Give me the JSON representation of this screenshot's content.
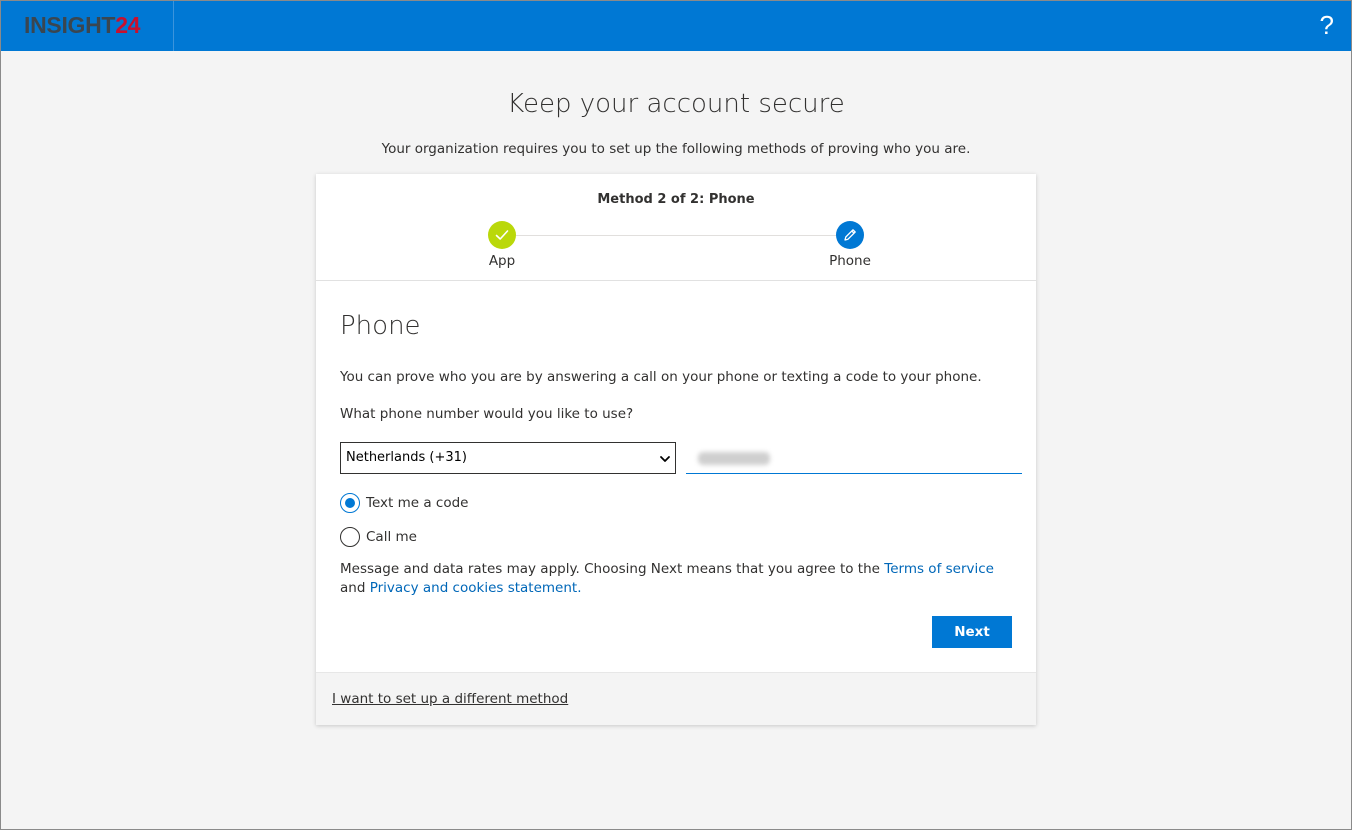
{
  "header": {
    "logo_part1": "INSIGHT",
    "logo_part2": "24",
    "help_label": "?",
    "brand_color": "#0078d4"
  },
  "page": {
    "title": "Keep your account secure",
    "subtitle": "Your organization requires you to set up the following methods of proving who you are."
  },
  "progress": {
    "label": "Method 2 of 2: Phone",
    "steps": [
      {
        "label": "App",
        "state": "completed",
        "icon": "checkmark-icon",
        "color": "#bad80a"
      },
      {
        "label": "Phone",
        "state": "current",
        "icon": "pencil-icon",
        "color": "#0078d4"
      }
    ]
  },
  "form": {
    "section_title": "Phone",
    "description": "You can prove who you are by answering a call on your phone or texting a code to your phone.",
    "question": "What phone number would you like to use?",
    "country_select": "Netherlands (+31)",
    "phone_number_redacted": true,
    "options": [
      {
        "label": "Text me a code",
        "selected": true
      },
      {
        "label": "Call me",
        "selected": false
      }
    ],
    "disclaimer_text": "Message and data rates may apply. Choosing Next means that you agree to the ",
    "terms_link": "Terms of service",
    "and_text": " and ",
    "privacy_link": "Privacy and cookies statement.",
    "next_button": "Next"
  },
  "footer": {
    "alt_method_link": "I want to set up a different method"
  }
}
